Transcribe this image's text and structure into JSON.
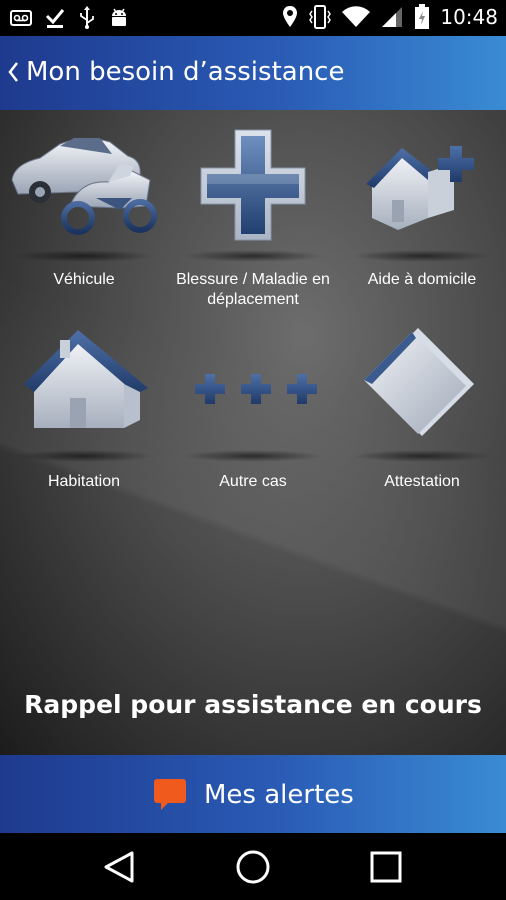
{
  "status_bar": {
    "time": "10:48",
    "left_icons": [
      "voicemail-icon",
      "download-done-icon",
      "usb-icon",
      "android-icon"
    ],
    "right_icons": [
      "location-icon",
      "vibrate-icon",
      "wifi-icon",
      "signal-icon",
      "battery-icon"
    ]
  },
  "header": {
    "title": "Mon besoin d’assistance",
    "back_icon": "chevron-left-icon"
  },
  "grid": {
    "items": [
      {
        "label": "Véhicule",
        "icon": "vehicle-car-motorbike-icon"
      },
      {
        "label": "Blessure / Maladie en déplacement",
        "icon": "medical-cross-icon"
      },
      {
        "label": "Aide à domicile",
        "icon": "home-plus-icon"
      },
      {
        "label": "Habitation",
        "icon": "house-icon"
      },
      {
        "label": "Autre cas",
        "icon": "three-crosses-icon"
      },
      {
        "label": "Attestation",
        "icon": "documents-icon"
      }
    ]
  },
  "footer_message": "Rappel pour assistance en cours",
  "alerts": {
    "label": "Mes alertes",
    "icon": "chat-bubble-icon"
  },
  "nav_bar": {
    "icons": [
      "back-icon",
      "home-icon",
      "recents-icon"
    ]
  },
  "colors": {
    "accent_blue": "#2a5bb5",
    "alert_orange": "#f05a1c"
  }
}
